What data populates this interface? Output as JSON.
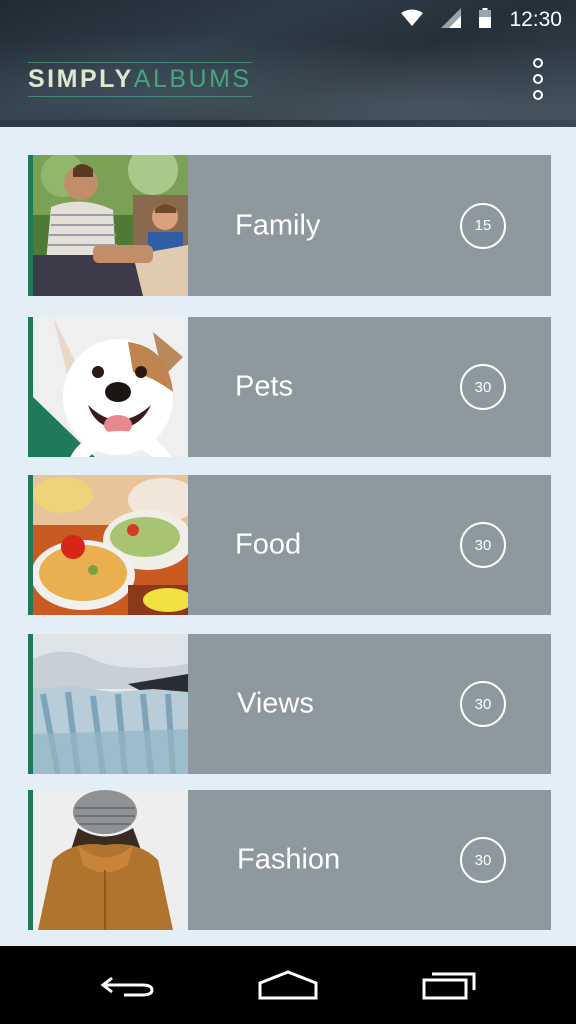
{
  "status_bar": {
    "time": "12:30",
    "icons": [
      "wifi-icon",
      "signal-icon",
      "battery-icon"
    ]
  },
  "app": {
    "logo_simply": "SIMPLY",
    "logo_albums": "ALBUMS",
    "menu_icon": "overflow-menu-icon"
  },
  "albums": [
    {
      "title": "Family",
      "count": "15",
      "image": "family-photo",
      "locked": false
    },
    {
      "title": "Pets",
      "count": "30",
      "image": "dog-photo",
      "locked": true
    },
    {
      "title": "Food",
      "count": "30",
      "image": "food-photo",
      "locked": false
    },
    {
      "title": "Views",
      "count": "30",
      "image": "glacier-photo",
      "locked": false
    },
    {
      "title": "Fashion",
      "count": "30",
      "image": "fashion-photo",
      "locked": false
    }
  ],
  "nav_bar": {
    "buttons": [
      "back-icon",
      "home-icon",
      "recents-icon"
    ]
  },
  "colors": {
    "accent": "#1f7a5a",
    "logo_green": "#43a581",
    "card_bg": "#8d989f",
    "page_bg": "#e4eef6"
  }
}
